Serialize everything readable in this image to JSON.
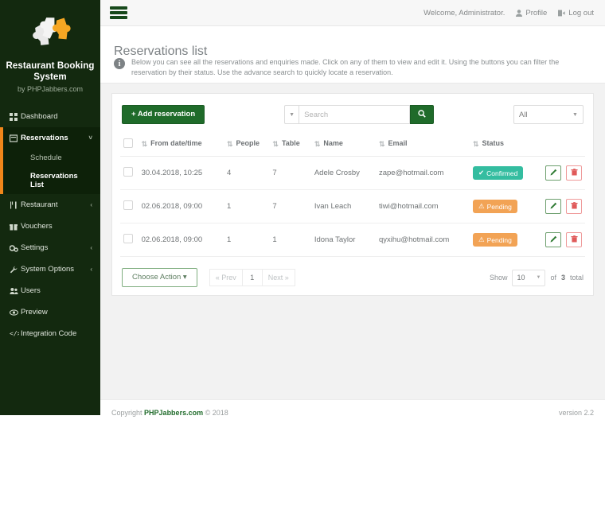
{
  "sidebar": {
    "brand_title": "Restaurant Booking System",
    "brand_sub": "by PHPJabbers.com",
    "logo_icon": "puzzle-pieces-icon",
    "items": [
      {
        "label": "Dashboard",
        "icon": "grid-icon",
        "caret": ""
      },
      {
        "label": "Reservations",
        "icon": "calendar-icon",
        "caret": "˅"
      },
      {
        "label": "Restaurant",
        "icon": "cutlery-icon",
        "caret": "‹"
      },
      {
        "label": "Vouchers",
        "icon": "gift-icon",
        "caret": ""
      },
      {
        "label": "Settings",
        "icon": "gears-icon",
        "caret": "‹"
      },
      {
        "label": "System Options",
        "icon": "wrench-icon",
        "caret": "‹"
      },
      {
        "label": "Users",
        "icon": "users-icon",
        "caret": ""
      },
      {
        "label": "Preview",
        "icon": "eye-icon",
        "caret": ""
      },
      {
        "label": "Integration Code",
        "icon": "code-icon",
        "caret": ""
      }
    ],
    "subitems": [
      {
        "label": "Schedule",
        "active": false
      },
      {
        "label": "Reservations List",
        "active": true
      }
    ]
  },
  "header": {
    "menu_icon": "hamburger-icon",
    "welcome": "Welcome, Administrator.",
    "profile_label": "Profile",
    "profile_icon": "user-icon",
    "logout_label": "Log out",
    "logout_icon": "sign-out-icon"
  },
  "page": {
    "title": "Reservations list",
    "info_icon": "info-circle-icon",
    "info_text": "Below you can see all the reservations and enquiries made. Click on any of them to view and edit it. Using the buttons you can filter the reservation by their status. Use the advance search to quickly locate a reservation."
  },
  "toolbar": {
    "add_label": "+ Add reservation",
    "search_caret_icon": "caret-down-icon",
    "search_placeholder": "Search",
    "search_value": "",
    "search_icon": "search-icon",
    "filter_value": "All",
    "filter_caret_icon": "caret-down-icon"
  },
  "table": {
    "select_all_icon": "checkbox-icon",
    "sort_icon": "sort-icon",
    "columns": [
      "From date/time",
      "People",
      "Table",
      "Name",
      "Email",
      "Status"
    ],
    "rows": [
      {
        "datetime": "30.04.2018, 10:25",
        "people": "4",
        "table": "7",
        "name": "Adele Crosby",
        "email": "zape@hotmail.com",
        "status": "Confirmed",
        "status_type": "confirmed",
        "status_icon": "check-icon",
        "edit_icon": "pencil-icon",
        "delete_icon": "trash-icon"
      },
      {
        "datetime": "02.06.2018, 09:00",
        "people": "1",
        "table": "7",
        "name": "Ivan Leach",
        "email": "tiwi@hotmail.com",
        "status": "Pending",
        "status_type": "pending",
        "status_icon": "warning-triangle-icon",
        "edit_icon": "pencil-icon",
        "delete_icon": "trash-icon"
      },
      {
        "datetime": "02.06.2018, 09:00",
        "people": "1",
        "table": "1",
        "name": "Idona Taylor",
        "email": "qyxihu@hotmail.com",
        "status": "Pending",
        "status_type": "pending",
        "status_icon": "warning-triangle-icon",
        "edit_icon": "pencil-icon",
        "delete_icon": "trash-icon"
      }
    ]
  },
  "footbar": {
    "action_label": "Choose Action",
    "action_caret_icon": "caret-down-icon",
    "prev_label": "« Prev",
    "current_page": "1",
    "next_label": "Next »",
    "show_label": "Show",
    "show_value": "10",
    "show_caret_icon": "caret-down-icon",
    "total_prefix": "of",
    "total_count": "3",
    "total_suffix": "total"
  },
  "footer": {
    "copyright_prefix": "Copyright",
    "brand": "PHPJabbers.com",
    "copyright_suffix": "© 2018",
    "version": "version 2.2"
  },
  "colors": {
    "sidebar_bg": "#13290f",
    "accent_orange": "#f0861a",
    "brand_green": "#1f6b2a",
    "confirmed": "#34bda0",
    "pending": "#f2a355",
    "content_bg": "#f2f2f2"
  }
}
